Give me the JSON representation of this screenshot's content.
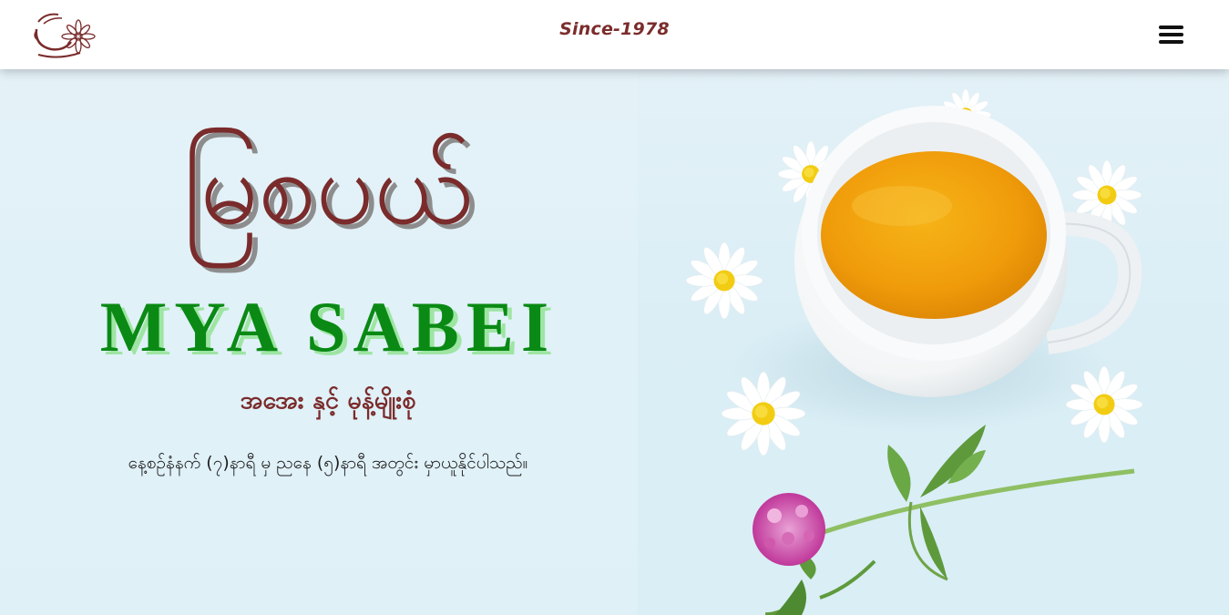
{
  "header": {
    "logo_icon": "teacup-flower-logo",
    "since_text": "Since-1978",
    "menu_icon": "hamburger-menu-icon"
  },
  "hero": {
    "title_mm": "မြစပယ်",
    "title_en": "MYA SABEI",
    "subtitle": "အအေး နှင့် မုန့်မျိုးစုံ",
    "hours": "နေ့စဉ်နံနက် (၇)နာရီ မှ ညနေ (၅)နာရီ အတွင်း မှာယူနိုင်ပါသည်။"
  },
  "colors": {
    "brand_maroon": "#7a2b2b",
    "brand_green": "#0a8a14",
    "hero_background": "#dcedf5",
    "tea": "#f2a20c"
  }
}
